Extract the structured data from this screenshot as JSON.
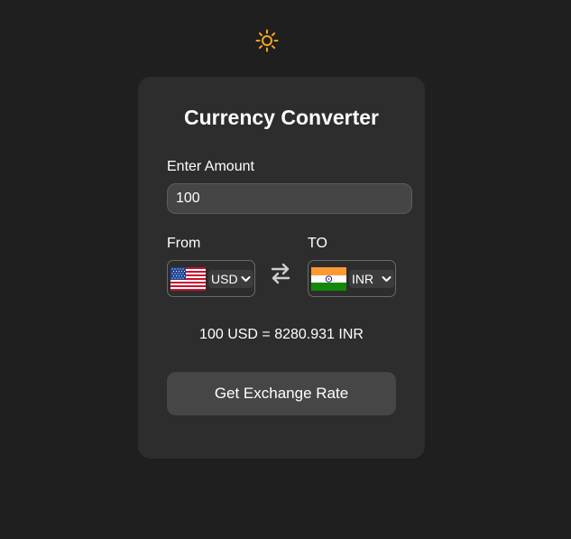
{
  "theme_toggle": {
    "icon": "sun-icon",
    "color": "#f5a623"
  },
  "card": {
    "title": "Currency Converter",
    "amount": {
      "label": "Enter Amount",
      "value": "100",
      "placeholder": ""
    },
    "from": {
      "label": "From",
      "selected": "USD",
      "flag_icon": "us-flag-icon"
    },
    "to": {
      "label": "TO",
      "selected": "INR",
      "flag_icon": "india-flag-icon"
    },
    "swap_icon": "swap-arrows-icon",
    "result": "100 USD = 8280.931 INR",
    "button_label": "Get Exchange Rate"
  },
  "colors": {
    "background": "#1f1f1f",
    "card": "#2d2d2d",
    "input": "#454545",
    "button": "#464646",
    "text": "#ffffff"
  }
}
